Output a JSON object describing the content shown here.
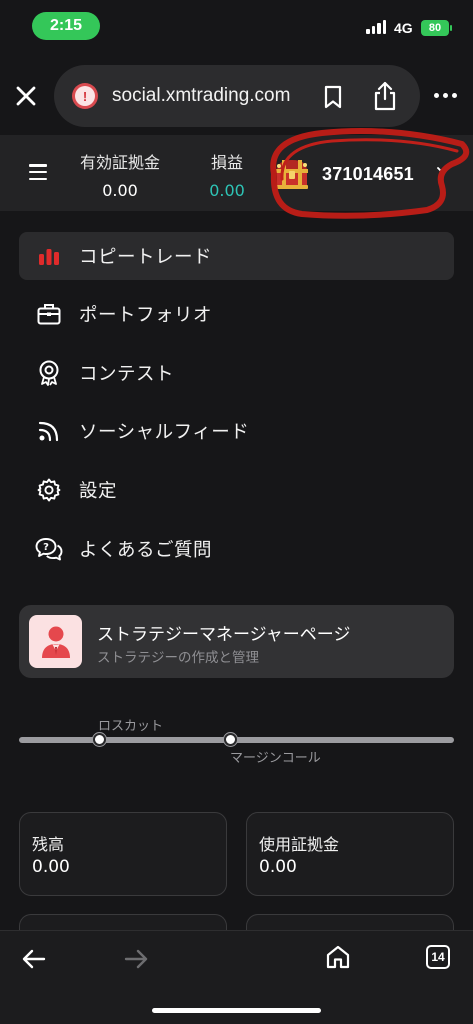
{
  "status_bar": {
    "time": "2:15",
    "network": "4G",
    "battery": "80"
  },
  "browser": {
    "url": "social.xmtrading.com",
    "icons": [
      "close-icon",
      "security-warning-icon",
      "bookmark-icon",
      "share-icon",
      "more-icon"
    ]
  },
  "header": {
    "margin_label": "有効証拠金",
    "margin_value": "0.00",
    "pnl_label": "損益",
    "pnl_value": "0.00",
    "account_number": "371014651",
    "colors": {
      "pnl": "#2ec4b6",
      "annotation": "#c0201a"
    }
  },
  "menu": {
    "items": [
      {
        "label": "コピートレード",
        "icon": "bar-chart-icon",
        "active": true
      },
      {
        "label": "ポートフォリオ",
        "icon": "briefcase-icon",
        "active": false
      },
      {
        "label": "コンテスト",
        "icon": "award-icon",
        "active": false
      },
      {
        "label": "ソーシャルフィード",
        "icon": "rss-icon",
        "active": false
      },
      {
        "label": "設定",
        "icon": "gear-icon",
        "active": false
      },
      {
        "label": "よくあるご質問",
        "icon": "faq-chat-icon",
        "active": false
      }
    ]
  },
  "strategy_card": {
    "title": "ストラテジーマネージャーページ",
    "subtitle": "ストラテジーの作成と管理"
  },
  "margin_slider": {
    "stop_out_label": "ロスカット",
    "margin_call_label": "マージンコール"
  },
  "cards": [
    {
      "label": "残高",
      "value": "0.00"
    },
    {
      "label": "使用証拠金",
      "value": "0.00"
    }
  ],
  "toolbar": {
    "tabs_count": "14",
    "icons": [
      "back-arrow-icon",
      "forward-arrow-icon",
      "home-icon",
      "tabs-icon"
    ]
  }
}
